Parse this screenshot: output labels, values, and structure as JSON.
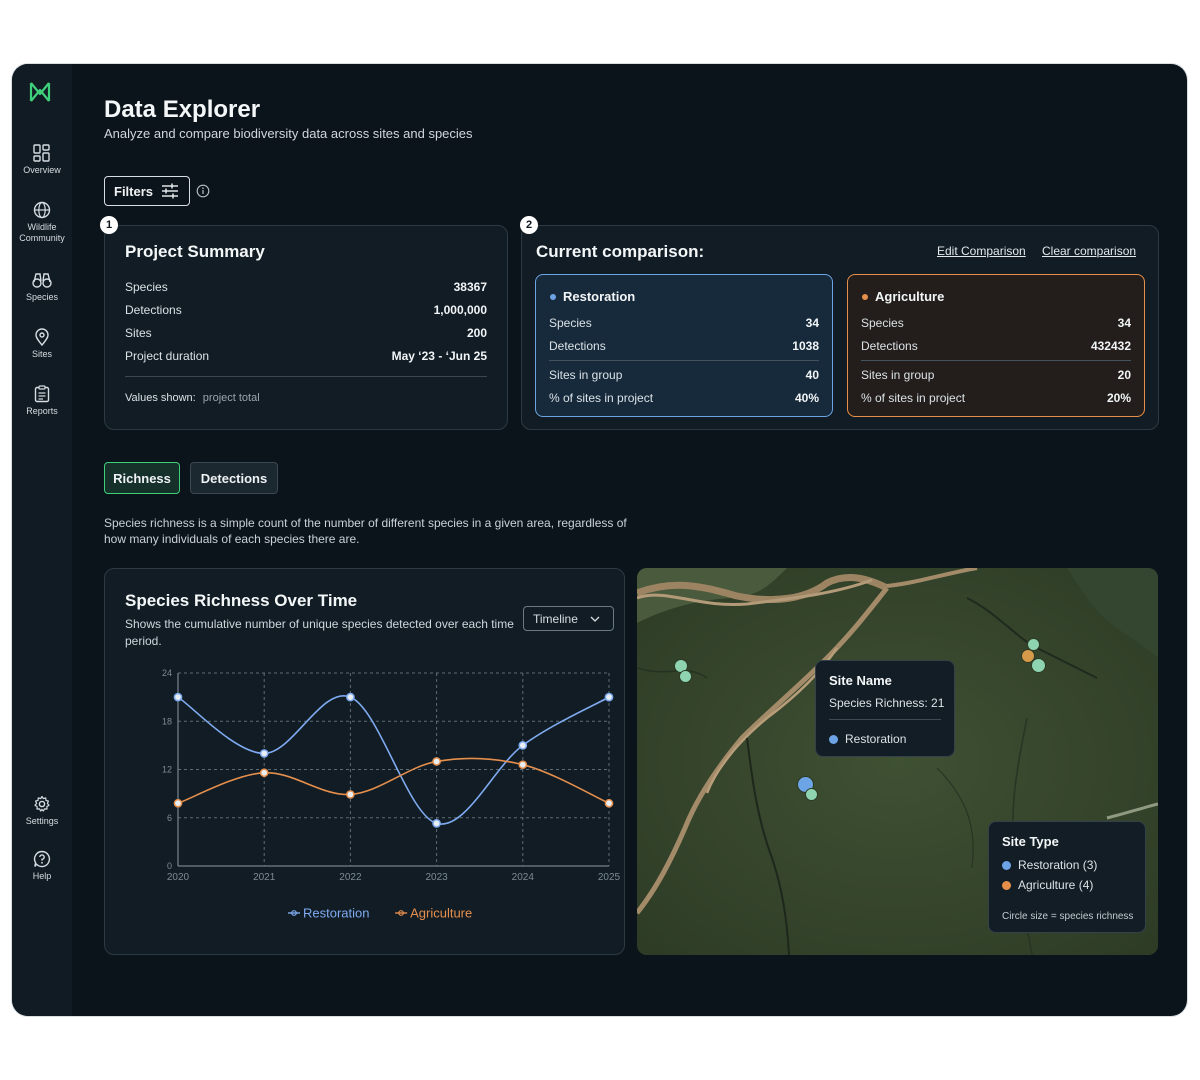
{
  "sidebar": {
    "items": [
      {
        "label": "Overview",
        "icon": "dashboard-icon"
      },
      {
        "label": "Wildlife Community",
        "icon": "globe-icon"
      },
      {
        "label": "Species",
        "icon": "binoculars-icon"
      },
      {
        "label": "Sites",
        "icon": "location-pin-icon"
      },
      {
        "label": "Reports",
        "icon": "clipboard-icon"
      }
    ],
    "bottom_items": [
      {
        "label": "Settings",
        "icon": "gear-icon"
      },
      {
        "label": "Help",
        "icon": "help-icon"
      }
    ]
  },
  "header": {
    "title": "Data Explorer",
    "subtitle": "Analyze and compare biodiversity data across sites and species"
  },
  "filters": {
    "label": "Filters"
  },
  "summary": {
    "step": "1",
    "title": "Project Summary",
    "rows": [
      {
        "label": "Species",
        "value": "38367"
      },
      {
        "label": "Detections",
        "value": "1,000,000"
      },
      {
        "label": "Sites",
        "value": "200"
      },
      {
        "label": "Project duration",
        "value": "May ‘23 - ‘Jun 25"
      }
    ],
    "values_shown_label": "Values shown:",
    "values_shown_value": "project total"
  },
  "comparison": {
    "step": "2",
    "title": "Current comparison:",
    "edit_label": "Edit Comparison",
    "clear_label": "Clear comparison",
    "groups": [
      {
        "name": "Restoration",
        "color": "#6da4e6",
        "rows": [
          {
            "label": "Species",
            "value": "34"
          },
          {
            "label": "Detections",
            "value": "1038"
          },
          {
            "label": "Sites in group",
            "value": "40"
          },
          {
            "label": "% of sites in project",
            "value": "40%"
          }
        ]
      },
      {
        "name": "Agriculture",
        "color": "#e5904a",
        "rows": [
          {
            "label": "Species",
            "value": "34"
          },
          {
            "label": "Detections",
            "value": "432432"
          },
          {
            "label": "Sites in group",
            "value": "20"
          },
          {
            "label": "% of sites in project",
            "value": "20%"
          }
        ]
      }
    ]
  },
  "tabs": [
    {
      "label": "Richness",
      "active": true
    },
    {
      "label": "Detections",
      "active": false
    }
  ],
  "description": "Species richness is a simple count of the number of different species in a given area, regardless of how many individuals of each species there are.",
  "chart": {
    "title": "Species Richness Over Time",
    "subtitle": "Shows the cumulative number of unique species detected over each time period.",
    "select_value": "Timeline"
  },
  "chart_data": {
    "type": "line",
    "x": [
      "2020",
      "2021",
      "2022",
      "2023",
      "2024",
      "2025"
    ],
    "yticks": [
      "0",
      "6",
      "12",
      "18",
      "24"
    ],
    "ylim": [
      0,
      24
    ],
    "grid": true,
    "legend_position": "bottom",
    "series": [
      {
        "name": "Restoration",
        "color": "#7eaaf0",
        "values": [
          21,
          14,
          21,
          5.3,
          15,
          21
        ]
      },
      {
        "name": "Agriculture",
        "color": "#e58f4d",
        "values": [
          7.8,
          11.6,
          8.9,
          13,
          12.6,
          7.8
        ]
      }
    ]
  },
  "map": {
    "tooltip": {
      "title": "Site Name",
      "metric": "Species Richness: 21",
      "group": "Restoration"
    },
    "legend": {
      "title": "Site Type",
      "items": [
        {
          "label": "Restoration (3)",
          "color": "#6da4e6"
        },
        {
          "label": "Agriculture (4)",
          "color": "#e5904a"
        }
      ],
      "note": "Circle size = species richness"
    }
  },
  "colors": {
    "accent": "#3ecf7a",
    "restoration": "#6da4e6",
    "agriculture": "#e5904a",
    "background": "#0c141b"
  }
}
